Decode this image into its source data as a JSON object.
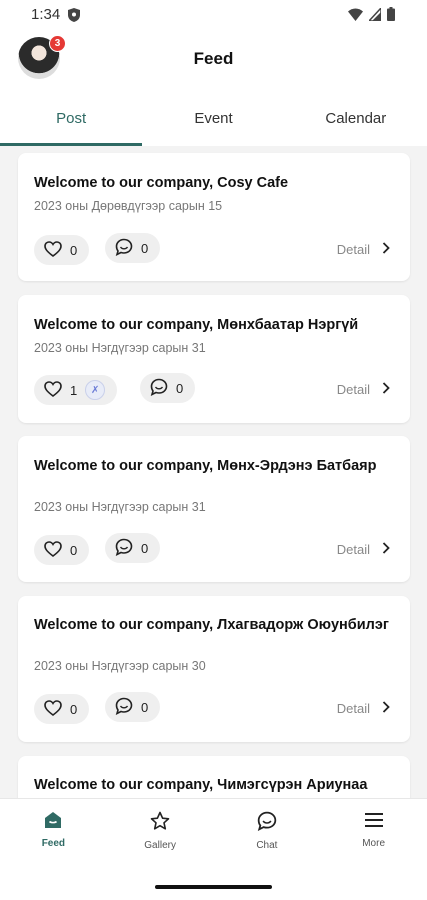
{
  "status_bar": {
    "time": "1:34"
  },
  "header": {
    "title": "Feed",
    "notification_count": "3"
  },
  "tabs": [
    {
      "label": "Post",
      "active": true
    },
    {
      "label": "Event",
      "active": false
    },
    {
      "label": "Calendar",
      "active": false
    }
  ],
  "posts": [
    {
      "title": "Welcome to our company, Cosy Cafe",
      "date": "2023 оны Дөрөвдүгээр сарын 15",
      "likes": "0",
      "comments": "0",
      "detail_label": "Detail"
    },
    {
      "title": "Welcome to our company, Мөнхбаатар Нэргүй",
      "date": "2023 оны Нэгдүгээр сарын 31",
      "likes": "1",
      "comments": "0",
      "detail_label": "Detail"
    },
    {
      "title": "Welcome to our company, Мөнх-Эрдэнэ Батбаяр",
      "date": "2023 оны Нэгдүгээр сарын 31",
      "likes": "0",
      "comments": "0",
      "detail_label": "Detail"
    },
    {
      "title": "Welcome to our company, Лхагвадорж Оюунбилэг",
      "date": "2023 оны Нэгдүгээр сарын 30",
      "likes": "0",
      "comments": "0",
      "detail_label": "Detail"
    },
    {
      "title": "Welcome to our company, Чимэгсүрэн Ариунаа",
      "date": "",
      "likes": "",
      "comments": "",
      "detail_label": ""
    }
  ],
  "bottom_nav": [
    {
      "label": "Feed",
      "icon": "home-icon",
      "active": true
    },
    {
      "label": "Gallery",
      "icon": "star-icon",
      "active": false
    },
    {
      "label": "Chat",
      "icon": "chat-icon",
      "active": false
    },
    {
      "label": "More",
      "icon": "menu-icon",
      "active": false
    }
  ],
  "colors": {
    "accent": "#2f6a64",
    "badge": "#e53935",
    "background": "#f3f3f3"
  }
}
